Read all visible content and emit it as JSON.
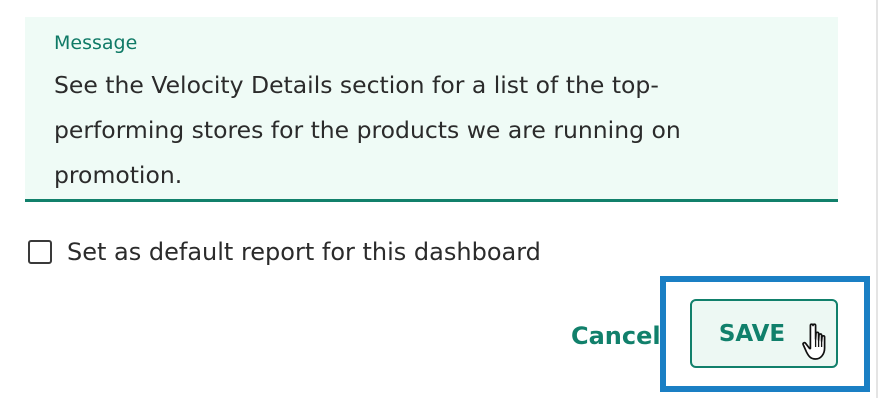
{
  "message": {
    "label": "Message",
    "text": "See the Velocity Details section for a list of the top-\nperforming stores for the products we are running on\npromotion."
  },
  "default_report": {
    "label": "Set as default report for this dashboard",
    "checked": false
  },
  "actions": {
    "cancel_label": "Cancel",
    "save_label": "SAVE"
  },
  "colors": {
    "accent": "#11806b",
    "field_background": "#effbf6",
    "highlight": "#1a7fc4"
  },
  "icons": {
    "cursor": "hand-pointer-icon"
  }
}
